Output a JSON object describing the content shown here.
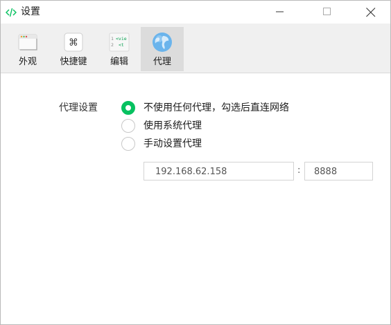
{
  "window": {
    "title": "设置",
    "icon": "code-brackets-icon",
    "controls": [
      "minimize-icon",
      "maximize-icon",
      "close-icon"
    ]
  },
  "toolbar": {
    "tabs": [
      {
        "label": "外观",
        "icon": "window-appearance-icon",
        "active": false
      },
      {
        "label": "快捷键",
        "icon": "command-key-icon",
        "active": false
      },
      {
        "label": "编辑",
        "icon": "code-editor-icon",
        "active": false
      },
      {
        "label": "代理",
        "icon": "globe-icon",
        "active": true
      }
    ]
  },
  "proxy": {
    "label": "代理设置",
    "options": [
      {
        "label": "不使用任何代理，勾选后直连网络",
        "checked": true
      },
      {
        "label": "使用系统代理",
        "checked": false
      },
      {
        "label": "手动设置代理",
        "checked": false
      }
    ],
    "host": {
      "value": "192.168.62.158"
    },
    "separator": ":",
    "port": {
      "value": "8888"
    }
  },
  "colors": {
    "accent": "#07c160",
    "toolbar_bg": "#f0f0f0",
    "active_tab_bg": "#dcdcdc"
  }
}
